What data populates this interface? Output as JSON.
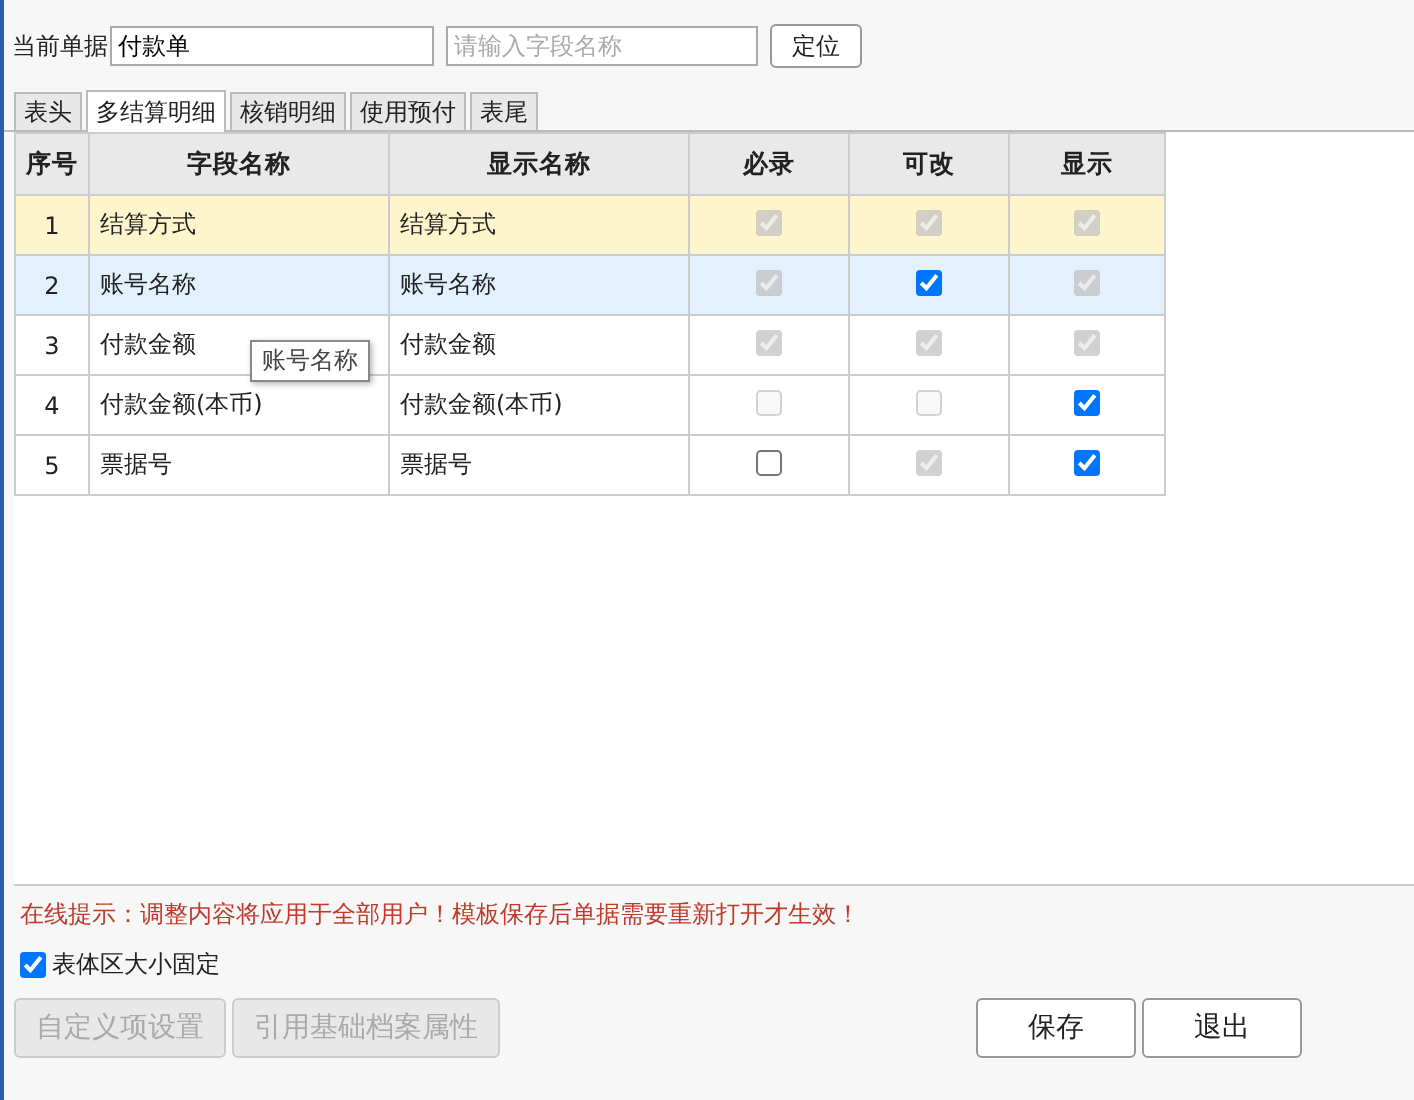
{
  "toolbar": {
    "label": "当前单据",
    "document": "付款单",
    "search_placeholder": "请输入字段名称",
    "locate_button": "定位"
  },
  "tabs": [
    {
      "label": "表头",
      "selected": false
    },
    {
      "label": "多结算明细",
      "selected": true
    },
    {
      "label": "核销明细",
      "selected": false
    },
    {
      "label": "使用预付",
      "selected": false
    },
    {
      "label": "表尾",
      "selected": false
    }
  ],
  "table": {
    "columns": [
      "序号",
      "字段名称",
      "显示名称",
      "必录",
      "可改",
      "显示"
    ],
    "rows": [
      {
        "index": "1",
        "field": "结算方式",
        "display": "结算方式",
        "selected": true,
        "hovered": false,
        "checks": [
          {
            "checked": true,
            "disabled": true
          },
          {
            "checked": true,
            "disabled": true
          },
          {
            "checked": true,
            "disabled": true
          }
        ]
      },
      {
        "index": "2",
        "field": "账号名称",
        "display": "账号名称",
        "selected": false,
        "hovered": true,
        "checks": [
          {
            "checked": true,
            "disabled": true
          },
          {
            "checked": true,
            "disabled": false
          },
          {
            "checked": true,
            "disabled": true
          }
        ]
      },
      {
        "index": "3",
        "field": "付款金额",
        "display": "付款金额",
        "selected": false,
        "hovered": false,
        "checks": [
          {
            "checked": true,
            "disabled": true
          },
          {
            "checked": true,
            "disabled": true
          },
          {
            "checked": true,
            "disabled": true
          }
        ]
      },
      {
        "index": "4",
        "field": "付款金额(本币)",
        "display": "付款金额(本币)",
        "selected": false,
        "hovered": false,
        "checks": [
          {
            "checked": false,
            "disabled": true
          },
          {
            "checked": false,
            "disabled": true
          },
          {
            "checked": true,
            "disabled": false
          }
        ]
      },
      {
        "index": "5",
        "field": "票据号",
        "display": "票据号",
        "selected": false,
        "hovered": false,
        "checks": [
          {
            "checked": false,
            "disabled": false
          },
          {
            "checked": true,
            "disabled": true
          },
          {
            "checked": true,
            "disabled": false
          }
        ]
      }
    ]
  },
  "tooltip": "账号名称",
  "hint": "在线提示：调整内容将应用于全部用户！模板保存后单据需要重新打开才生效！",
  "fixed_size": {
    "label": "表体区大小固定",
    "checked": true
  },
  "left_buttons": [
    {
      "label": "自定义项设置",
      "disabled": true
    },
    {
      "label": "引用基础档案属性",
      "disabled": true
    }
  ],
  "right_buttons": [
    {
      "label": "保存",
      "disabled": false
    },
    {
      "label": "退出",
      "disabled": false
    }
  ]
}
